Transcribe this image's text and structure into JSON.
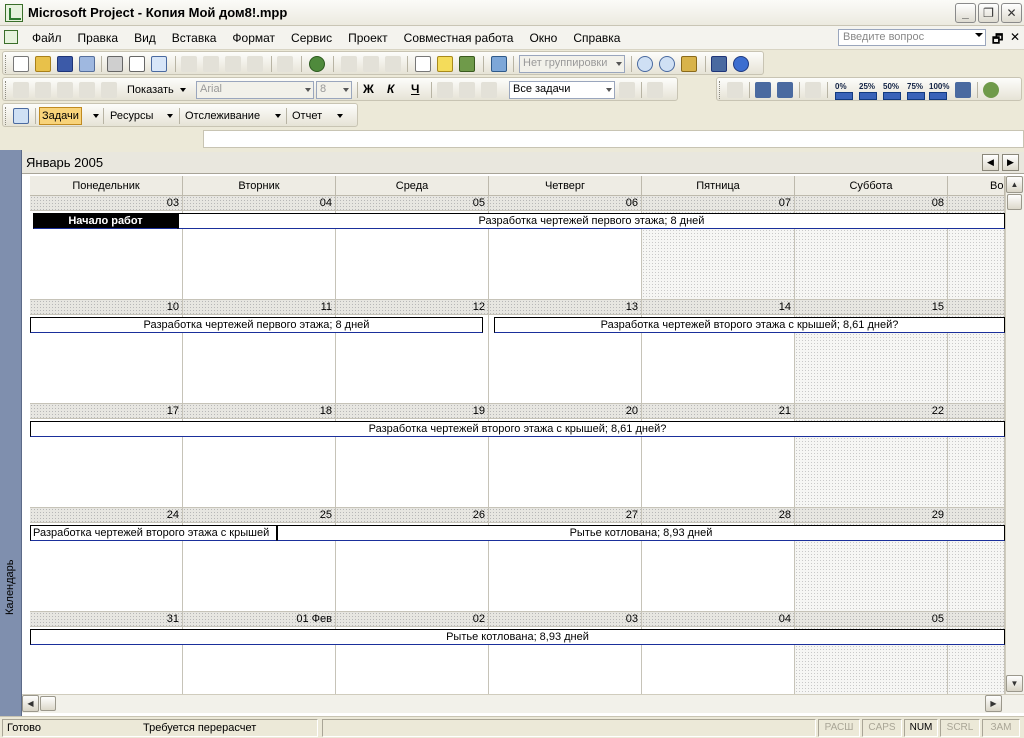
{
  "window": {
    "title": "Microsoft Project - Копия Мой дом8!.mpp",
    "minimize": "_",
    "restore": "❐",
    "close": "✕"
  },
  "menu": {
    "items": [
      "Файл",
      "Правка",
      "Вид",
      "Вставка",
      "Формат",
      "Сервис",
      "Проект",
      "Совместная работа",
      "Окно",
      "Справка"
    ],
    "ask_placeholder": "Введите вопрос",
    "doc_restore": "🗗",
    "doc_close": "✕"
  },
  "toolbar_standard": {
    "grouping": "Нет группировки"
  },
  "toolbar_formatting": {
    "show_label": "Показать",
    "font": "Arial",
    "size": "8",
    "bold": "Ж",
    "italic": "К",
    "underline": "Ч",
    "filter": "Все задачи",
    "progress": [
      "0%",
      "25%",
      "50%",
      "75%",
      "100%"
    ]
  },
  "toolbar_guide": {
    "buttons": [
      "Задачи",
      "Ресурсы",
      "Отслеживание",
      "Отчет"
    ]
  },
  "view_bar": {
    "label": "Календарь"
  },
  "calendar": {
    "month": "Январь 2005",
    "weekdays": [
      "Понедельник",
      "Вторник",
      "Среда",
      "Четверг",
      "Пятница",
      "Суббота",
      "Во"
    ],
    "weeks": [
      {
        "days": [
          "03",
          "04",
          "05",
          "06",
          "07",
          "08",
          ""
        ],
        "tasks": [
          {
            "name": "Начало работ",
            "milestone": true
          },
          {
            "name": "Разработка чертежей первого этажа; 8 дней"
          }
        ]
      },
      {
        "days": [
          "10",
          "11",
          "12",
          "13",
          "14",
          "15",
          ""
        ],
        "tasks": [
          {
            "name": "Разработка чертежей первого этажа; 8 дней"
          },
          {
            "name": "Разработка чертежей второго этажа с крышей; 8,61 дней?"
          }
        ]
      },
      {
        "days": [
          "17",
          "18",
          "19",
          "20",
          "21",
          "22",
          ""
        ],
        "tasks": [
          {
            "name": "Разработка чертежей второго этажа с крышей; 8,61 дней?"
          }
        ]
      },
      {
        "days": [
          "24",
          "25",
          "26",
          "27",
          "28",
          "29",
          ""
        ],
        "tasks": [
          {
            "name": "Разработка чертежей второго этажа с крышей"
          },
          {
            "name": "Рытье котлована; 8,93 дней"
          }
        ]
      },
      {
        "days": [
          "31",
          "01 Фев",
          "02",
          "03",
          "04",
          "05",
          ""
        ],
        "tasks": [
          {
            "name": "Рытье котлована; 8,93 дней"
          }
        ]
      }
    ]
  },
  "status": {
    "ready": "Готово",
    "message": "Требуется перерасчет",
    "indicators": [
      {
        "label": "РАСШ",
        "active": false
      },
      {
        "label": "CAPS",
        "active": false
      },
      {
        "label": "NUM",
        "active": true
      },
      {
        "label": "SCRL",
        "active": false
      },
      {
        "label": "ЗАМ",
        "active": false
      }
    ]
  }
}
